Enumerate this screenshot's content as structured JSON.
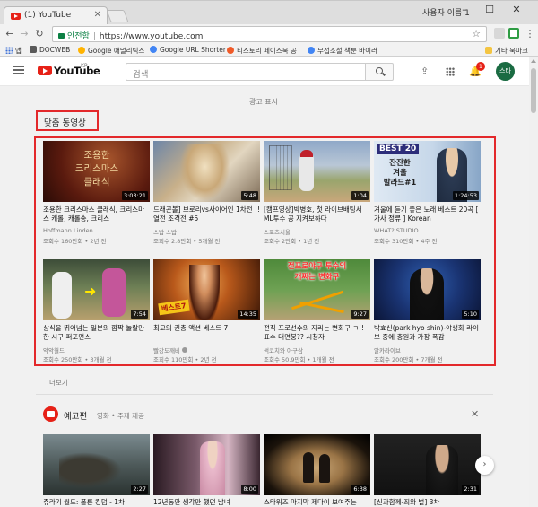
{
  "browser": {
    "tab_title": "(1) YouTube",
    "window_user": "사용자 이름 1",
    "secure_label": "안전함",
    "url": "https://www.youtube.com",
    "bookmarks": [
      "앱",
      "DOCWEB",
      "Google 애널리틱스",
      "Google URL Shorter",
      "티스토리 페이스북 공",
      "무접소설 책분 바이러",
      "기타 북마크"
    ]
  },
  "header": {
    "logo": "YouTube",
    "logo_region": "KR",
    "search_placeholder": "검색",
    "notification_count": "1",
    "avatar_text": "스타"
  },
  "ad_label": "광고 표시",
  "section1": {
    "title": "맞춤 동영상",
    "more_label": "더보기",
    "videos": [
      {
        "title": "조용한 크리스마스 클래식, 크리스마스 캐롤, 캐롤송, 크리스",
        "channel": "Hoffmann Linden",
        "meta": "조회수 160만회 • 2년 전",
        "duration": "3:03:21",
        "overlay": "조용한\n크리스마스\n클래식",
        "verified": false
      },
      {
        "title": "드래곤볼] 브로리vs사이어인 1차전 !! 열전 조격전 #5",
        "channel": "스밥 스밥",
        "meta": "조회수 2.8만회 • 5개월 전",
        "duration": "5:48",
        "overlay": "",
        "verified": false
      },
      {
        "title": "[캠프영상]박병호, 첫 라이브배팅서 ML투수 공 지켜보하다",
        "channel": "스포츠서울",
        "meta": "조회수 2만회 • 1년 전",
        "duration": "1:04",
        "overlay": "",
        "verified": false
      },
      {
        "title": "겨울에 듣기 좋은 노래 베스트 20곡 [ 가사 정류 ] Korean",
        "channel": "WHAT? STUDIO",
        "meta": "조회수 310만회 • 4주 전",
        "duration": "1:24:53",
        "overlay": "BEST 20",
        "overlay2": "잔잔한\n겨울\n발라드#1",
        "verified": false
      },
      {
        "title": "상식을 뛰어넘는 일본의 깜짝 놀랄만한 시구 퍼포먼스",
        "channel": "악악월드",
        "meta": "조회수 250만회 • 3개월 전",
        "duration": "7:54",
        "overlay": "",
        "verified": false
      },
      {
        "title": "최고의 권총 액션 베스트 7",
        "channel": "빨강도깨비",
        "meta": "조회수 110만회 • 2년 전",
        "duration": "14:35",
        "overlay": "베스트7",
        "verified": true
      },
      {
        "title": "전직 프로선수의 지리는 변화구 ㅋ!! 표수 대면붕?? 시청자",
        "channel": "썩코치와 아구삼",
        "meta": "조회수 50.9만회 • 1개월 전",
        "duration": "9:27",
        "overlay": "전프로야구 투수의\n개쩌는 변화구",
        "verified": false
      },
      {
        "title": "박효신(park hyo shin)-야생화 라이브 중에 충원과 가장 폭감",
        "channel": "알카라이브",
        "meta": "조회수 200만회 • 7개월 전",
        "duration": "5:10",
        "overlay": "",
        "verified": false
      }
    ]
  },
  "section2": {
    "title": "예고편",
    "subtitle": "영화 • 주제 제공",
    "videos": [
      {
        "title": "쥬라기 월드: 폴른 킹덤 - 1차",
        "duration": "2:27"
      },
      {
        "title": "12년동안 생각만 했던 남녀",
        "duration": "8:00"
      },
      {
        "title": "스타워즈 마지막 제다이 보여주는",
        "duration": "6:38"
      },
      {
        "title": "[신과함께-죄와 벌] 3차",
        "duration": "2:31"
      }
    ]
  },
  "colors": {
    "accent": "#e62117",
    "annotation": "#e3282b"
  }
}
